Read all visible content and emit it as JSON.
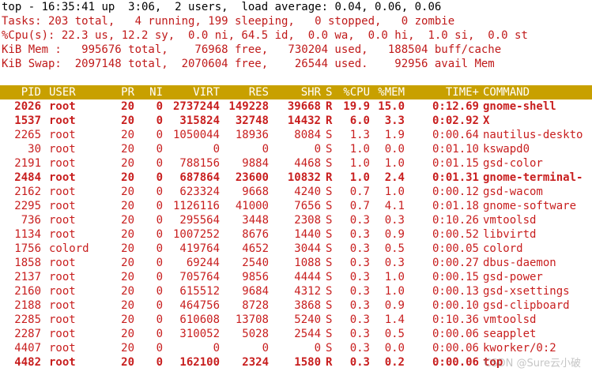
{
  "summary": {
    "line1": {
      "label": "top - ",
      "time": "16:35:41",
      "up": " up  3:06,  2 users,  load average: ",
      "load": "0.04, 0.06, 0.06"
    },
    "tasks": "Tasks: 203 total,   4 running, 199 sleeping,   0 stopped,   0 zombie",
    "cpu": "%Cpu(s): 22.3 us, 12.2 sy,  0.0 ni, 64.5 id,  0.0 wa,  0.0 hi,  1.0 si,  0.0 st",
    "mem": "KiB Mem :   995676 total,    76968 free,   730204 used,   188504 buff/cache",
    "swap": "KiB Swap:  2097148 total,  2070604 free,    26544 used.    92956 avail Mem"
  },
  "columns": {
    "pid": "PID",
    "user": "USER",
    "pr": "PR",
    "ni": "NI",
    "virt": "VIRT",
    "res": "RES",
    "shr": "SHR",
    "s": "S",
    "cpu": "%CPU",
    "mem": "%MEM",
    "time": "TIME+",
    "command": "COMMAND"
  },
  "processes": [
    {
      "pid": "2026",
      "user": "root",
      "pr": "20",
      "ni": "0",
      "virt": "2737244",
      "res": "149228",
      "shr": "39668",
      "s": "R",
      "cpu": "19.9",
      "mem": "15.0",
      "time": "0:12.69",
      "command": "gnome-shell",
      "bold": true
    },
    {
      "pid": "1537",
      "user": "root",
      "pr": "20",
      "ni": "0",
      "virt": "315824",
      "res": "32748",
      "shr": "14432",
      "s": "R",
      "cpu": "6.0",
      "mem": "3.3",
      "time": "0:02.92",
      "command": "X",
      "bold": true
    },
    {
      "pid": "2265",
      "user": "root",
      "pr": "20",
      "ni": "0",
      "virt": "1050044",
      "res": "18936",
      "shr": "8084",
      "s": "S",
      "cpu": "1.3",
      "mem": "1.9",
      "time": "0:00.64",
      "command": "nautilus-deskto",
      "bold": false
    },
    {
      "pid": "30",
      "user": "root",
      "pr": "20",
      "ni": "0",
      "virt": "0",
      "res": "0",
      "shr": "0",
      "s": "S",
      "cpu": "1.0",
      "mem": "0.0",
      "time": "0:01.10",
      "command": "kswapd0",
      "bold": false
    },
    {
      "pid": "2191",
      "user": "root",
      "pr": "20",
      "ni": "0",
      "virt": "788156",
      "res": "9884",
      "shr": "4468",
      "s": "S",
      "cpu": "1.0",
      "mem": "1.0",
      "time": "0:01.15",
      "command": "gsd-color",
      "bold": false
    },
    {
      "pid": "2484",
      "user": "root",
      "pr": "20",
      "ni": "0",
      "virt": "687864",
      "res": "23600",
      "shr": "10832",
      "s": "R",
      "cpu": "1.0",
      "mem": "2.4",
      "time": "0:01.31",
      "command": "gnome-terminal-",
      "bold": true
    },
    {
      "pid": "2162",
      "user": "root",
      "pr": "20",
      "ni": "0",
      "virt": "623324",
      "res": "9668",
      "shr": "4240",
      "s": "S",
      "cpu": "0.7",
      "mem": "1.0",
      "time": "0:00.12",
      "command": "gsd-wacom",
      "bold": false
    },
    {
      "pid": "2295",
      "user": "root",
      "pr": "20",
      "ni": "0",
      "virt": "1126116",
      "res": "41000",
      "shr": "7656",
      "s": "S",
      "cpu": "0.7",
      "mem": "4.1",
      "time": "0:01.18",
      "command": "gnome-software",
      "bold": false
    },
    {
      "pid": "736",
      "user": "root",
      "pr": "20",
      "ni": "0",
      "virt": "295564",
      "res": "3448",
      "shr": "2308",
      "s": "S",
      "cpu": "0.3",
      "mem": "0.3",
      "time": "0:10.26",
      "command": "vmtoolsd",
      "bold": false
    },
    {
      "pid": "1134",
      "user": "root",
      "pr": "20",
      "ni": "0",
      "virt": "1007252",
      "res": "8676",
      "shr": "1440",
      "s": "S",
      "cpu": "0.3",
      "mem": "0.9",
      "time": "0:00.52",
      "command": "libvirtd",
      "bold": false
    },
    {
      "pid": "1756",
      "user": "colord",
      "pr": "20",
      "ni": "0",
      "virt": "419764",
      "res": "4652",
      "shr": "3044",
      "s": "S",
      "cpu": "0.3",
      "mem": "0.5",
      "time": "0:00.05",
      "command": "colord",
      "bold": false
    },
    {
      "pid": "1858",
      "user": "root",
      "pr": "20",
      "ni": "0",
      "virt": "69244",
      "res": "2540",
      "shr": "1088",
      "s": "S",
      "cpu": "0.3",
      "mem": "0.3",
      "time": "0:00.27",
      "command": "dbus-daemon",
      "bold": false
    },
    {
      "pid": "2137",
      "user": "root",
      "pr": "20",
      "ni": "0",
      "virt": "705764",
      "res": "9856",
      "shr": "4444",
      "s": "S",
      "cpu": "0.3",
      "mem": "1.0",
      "time": "0:00.15",
      "command": "gsd-power",
      "bold": false
    },
    {
      "pid": "2160",
      "user": "root",
      "pr": "20",
      "ni": "0",
      "virt": "615512",
      "res": "9684",
      "shr": "4312",
      "s": "S",
      "cpu": "0.3",
      "mem": "1.0",
      "time": "0:00.13",
      "command": "gsd-xsettings",
      "bold": false
    },
    {
      "pid": "2188",
      "user": "root",
      "pr": "20",
      "ni": "0",
      "virt": "464756",
      "res": "8728",
      "shr": "3868",
      "s": "S",
      "cpu": "0.3",
      "mem": "0.9",
      "time": "0:00.10",
      "command": "gsd-clipboard",
      "bold": false
    },
    {
      "pid": "2285",
      "user": "root",
      "pr": "20",
      "ni": "0",
      "virt": "610608",
      "res": "13708",
      "shr": "5240",
      "s": "S",
      "cpu": "0.3",
      "mem": "1.4",
      "time": "0:10.36",
      "command": "vmtoolsd",
      "bold": false
    },
    {
      "pid": "2287",
      "user": "root",
      "pr": "20",
      "ni": "0",
      "virt": "310052",
      "res": "5028",
      "shr": "2544",
      "s": "S",
      "cpu": "0.3",
      "mem": "0.5",
      "time": "0:00.06",
      "command": "seapplet",
      "bold": false
    },
    {
      "pid": "4407",
      "user": "root",
      "pr": "20",
      "ni": "0",
      "virt": "0",
      "res": "0",
      "shr": "0",
      "s": "S",
      "cpu": "0.3",
      "mem": "0.0",
      "time": "0:00.06",
      "command": "kworker/0:2",
      "bold": false
    },
    {
      "pid": "4482",
      "user": "root",
      "pr": "20",
      "ni": "0",
      "virt": "162100",
      "res": "2324",
      "shr": "1580",
      "s": "R",
      "cpu": "0.3",
      "mem": "0.2",
      "time": "0:00.06",
      "command": "top",
      "bold": true
    }
  ],
  "watermark": "CSDN @Sure云小破",
  "colors": {
    "header_bar": "#c8a000",
    "text_red": "#c81e1e",
    "background": "#ffffff"
  }
}
